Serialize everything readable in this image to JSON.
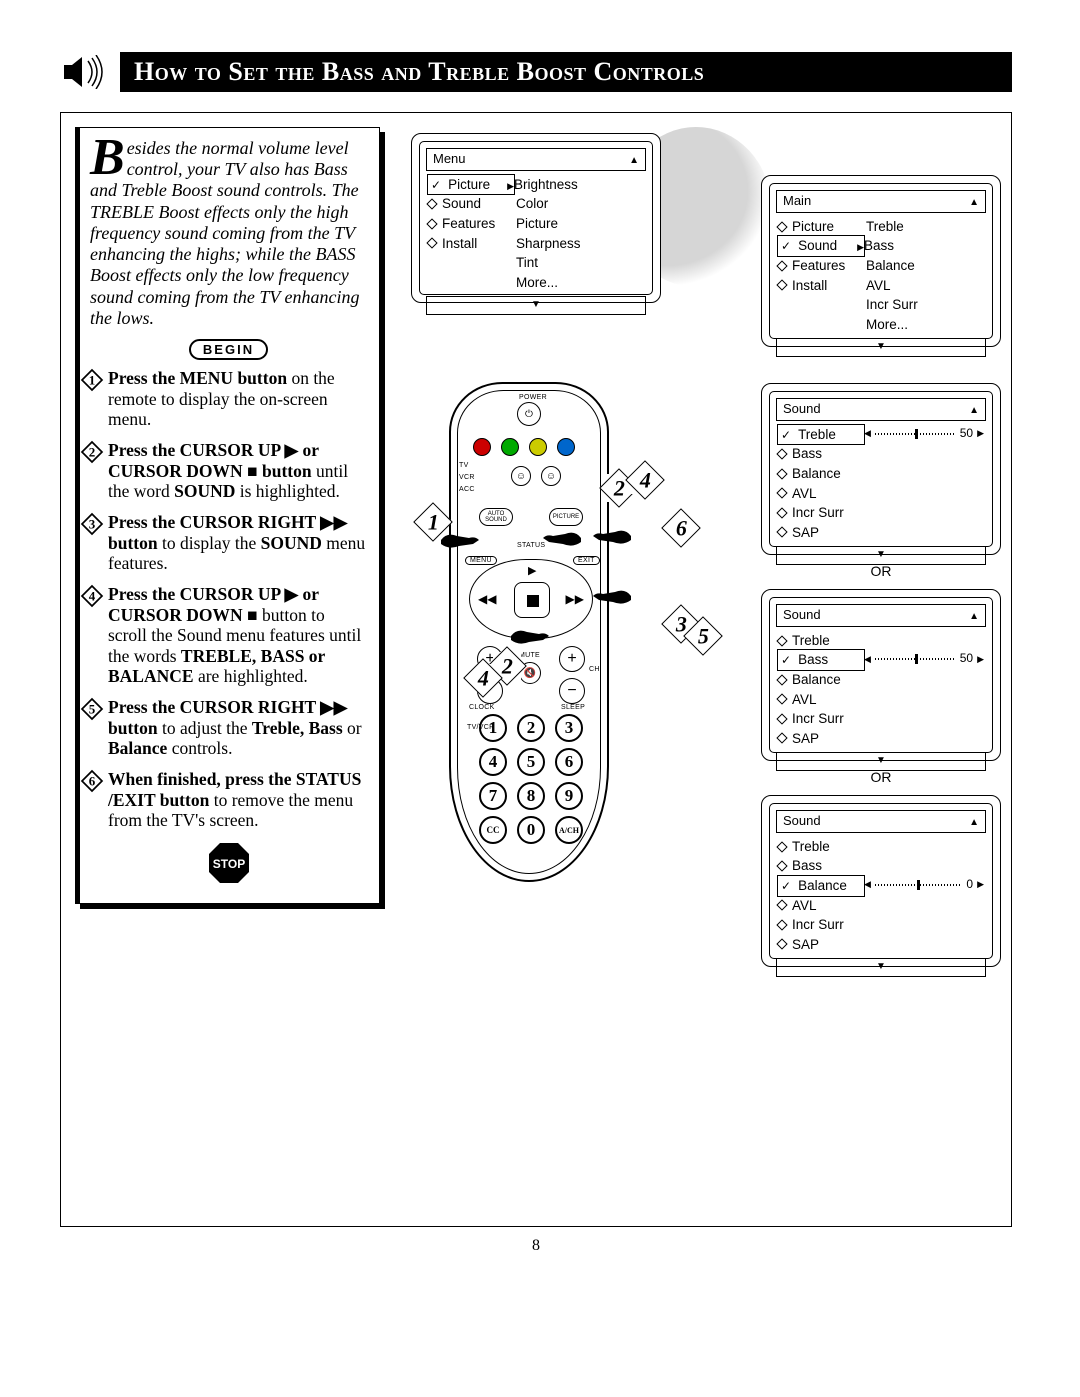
{
  "header": {
    "title": "How to Set the Bass and Treble Boost Controls"
  },
  "intro": {
    "dropcap": "B",
    "text": "esides the normal volume level control, your TV also has Bass and Treble Boost sound controls. The TREBLE Boost effects only the high frequency sound coming from the TV enhancing the highs; while the BASS Boost effects only the low frequency sound coming from the TV enhancing the lows."
  },
  "begin_label": "BEGIN",
  "stop_label": "STOP",
  "steps": [
    {
      "n": "1",
      "bold": "Press the MENU button",
      "rest": " on the remote to display the on-screen menu."
    },
    {
      "n": "2",
      "bold": "Press the CURSOR UP ▶ or CURSOR DOWN ■ button",
      "rest": " until the word SOUND is highlighted.",
      "extra_bold": "SOUND"
    },
    {
      "n": "3",
      "bold": "Press the CURSOR RIGHT ▶▶ button",
      "rest": " to display the SOUND menu features.",
      "extra_bold": "SOUND"
    },
    {
      "n": "4",
      "bold": "Press the CURSOR UP ▶ or CURSOR DOWN ■",
      "rest": " button to scroll the Sound menu features until the words TREBLE, BASS or BALANCE are highlighted.",
      "extra_bold": "TREBLE, BASS or BALANCE"
    },
    {
      "n": "5",
      "bold": "Press the CURSOR RIGHT ▶▶ button",
      "rest": " to adjust the Treble, Bass or Balance controls.",
      "extra_bold": "Treble, Bass",
      "extra_bold2": "Balance"
    },
    {
      "n": "6",
      "bold": "When finished, press the STATUS /EXIT button",
      "rest": " to remove the menu from the TV's screen."
    }
  ],
  "osd1": {
    "title": "Menu",
    "left": [
      {
        "t": "Picture",
        "sel": true,
        "arrow": true
      },
      {
        "t": "Sound"
      },
      {
        "t": "Features"
      },
      {
        "t": "Install"
      }
    ],
    "right": [
      "Brightness",
      "Color",
      "Picture",
      "Sharpness",
      "Tint",
      "More..."
    ]
  },
  "osd2": {
    "title": "Main",
    "left": [
      {
        "t": "Picture"
      },
      {
        "t": "Sound",
        "sel": true,
        "arrow": true
      },
      {
        "t": "Features"
      },
      {
        "t": "Install"
      }
    ],
    "right": [
      "Treble",
      "Bass",
      "Balance",
      "AVL",
      "Incr Surr",
      "More..."
    ]
  },
  "osd3": {
    "title": "Sound",
    "left": [
      {
        "t": "Treble",
        "sel": true,
        "slider": 50
      },
      {
        "t": "Bass"
      },
      {
        "t": "Balance"
      },
      {
        "t": "AVL"
      },
      {
        "t": "Incr Surr"
      },
      {
        "t": "SAP"
      }
    ]
  },
  "osd4": {
    "title": "Sound",
    "left": [
      {
        "t": "Treble"
      },
      {
        "t": "Bass",
        "sel": true,
        "slider": 50
      },
      {
        "t": "Balance"
      },
      {
        "t": "AVL"
      },
      {
        "t": "Incr Surr"
      },
      {
        "t": "SAP"
      }
    ]
  },
  "osd5": {
    "title": "Sound",
    "left": [
      {
        "t": "Treble"
      },
      {
        "t": "Bass"
      },
      {
        "t": "Balance",
        "sel": true,
        "slider": 0,
        "center": true
      },
      {
        "t": "AVL"
      },
      {
        "t": "Incr Surr"
      },
      {
        "t": "SAP"
      }
    ]
  },
  "or_label": "OR",
  "remote": {
    "power": "POWER",
    "tv": "TV",
    "vcr": "VCR",
    "acc": "ACC",
    "auto_sound": "AUTO SOUND",
    "picture": "PICTURE",
    "menu": "MENU",
    "status": "STATUS",
    "exit": "EXIT",
    "mute": "MUTE",
    "ch": "CH",
    "clock": "CLOCK",
    "sleep": "SLEEP",
    "tvvcr": "TV/VCR",
    "keys": [
      "1",
      "2",
      "3",
      "4",
      "5",
      "6",
      "7",
      "8",
      "9",
      "CC",
      "0",
      "A/CH"
    ]
  },
  "callouts": [
    "1",
    "2",
    "3",
    "4",
    "5",
    "6"
  ],
  "page_number": "8"
}
